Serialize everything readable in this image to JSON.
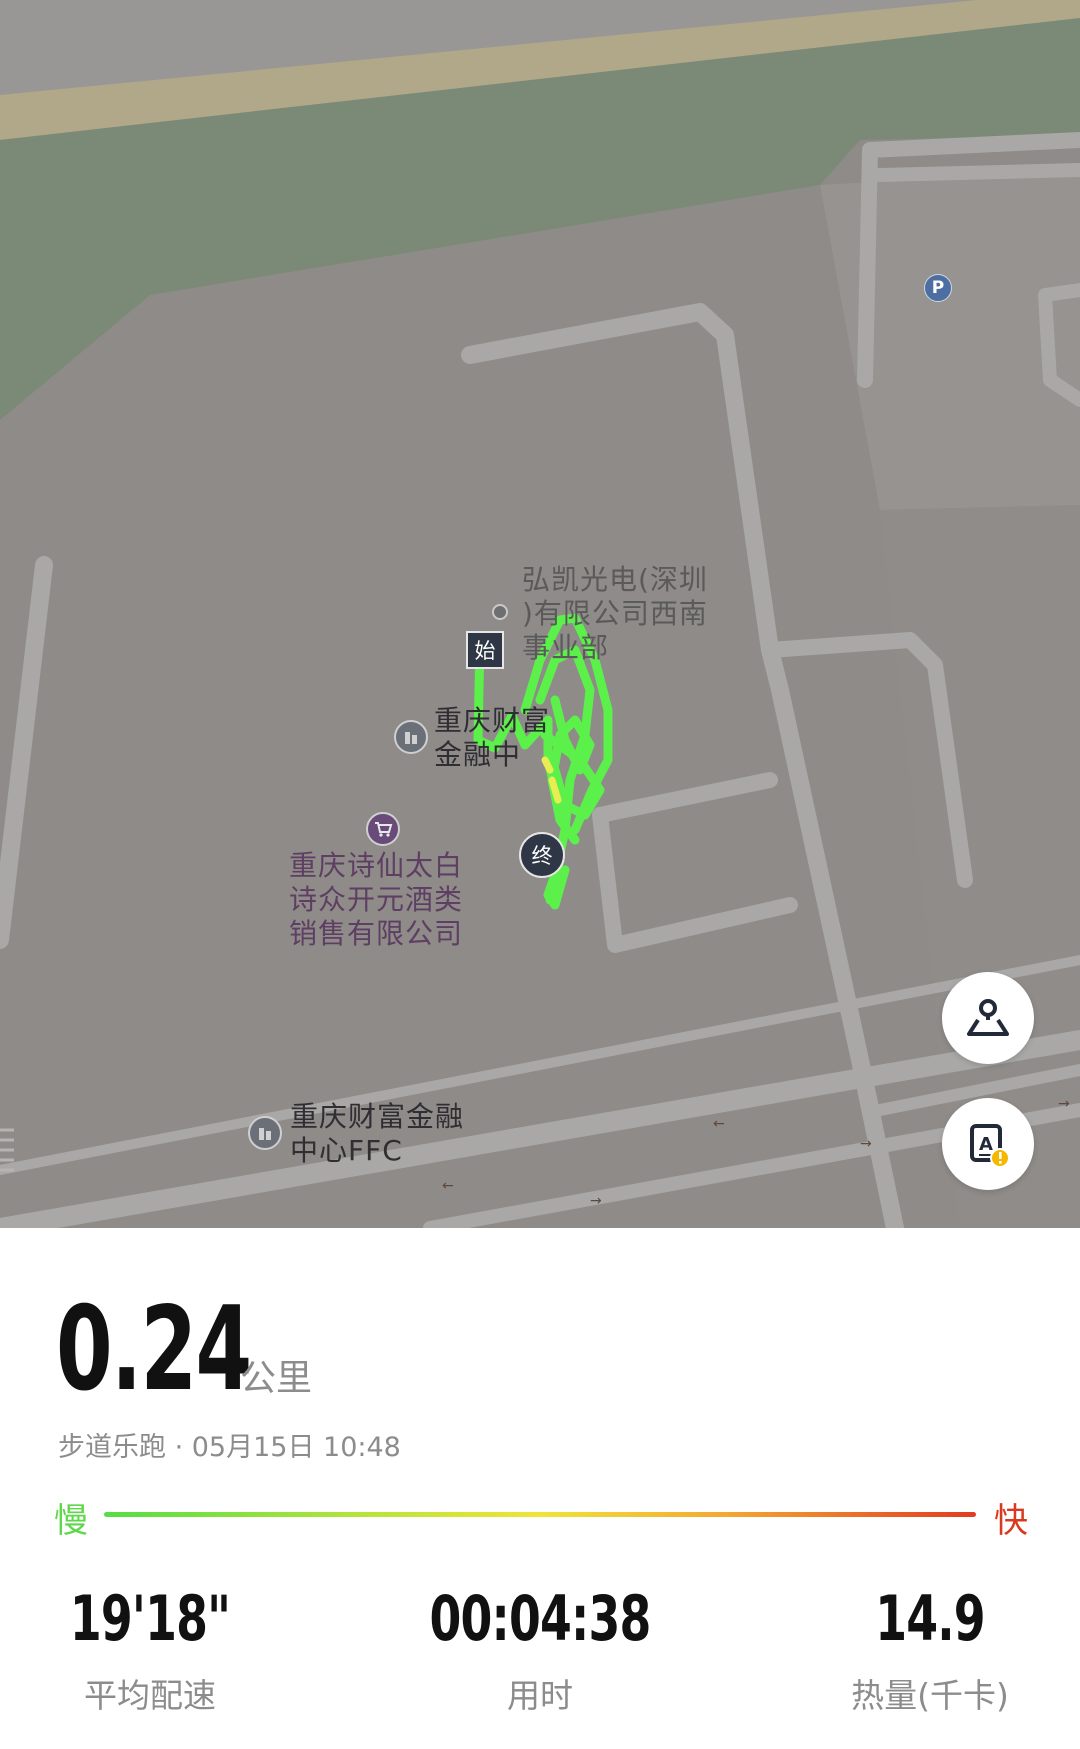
{
  "map": {
    "pois": [
      {
        "name": "弘凯光电(深圳\n)有限公司西南\n事业部"
      },
      {
        "name": "重庆财富\n金融中"
      },
      {
        "name": "重庆诗仙太白\n诗众开元酒类\n销售有限公司"
      },
      {
        "name": "重庆财富金融\n中心FFC"
      }
    ],
    "start_marker": "始",
    "end_marker": "终",
    "track_color": "#5cf04a",
    "icons": [
      "parking-icon",
      "building-icon",
      "shopping-cart-icon",
      "location-person-icon",
      "legend-alert-icon"
    ]
  },
  "summary": {
    "distance": "0.24",
    "distance_unit": "公里",
    "meta": "步道乐跑 · 05月15日 10:48"
  },
  "pace_scale": {
    "slow_label": "慢",
    "fast_label": "快",
    "slow_color": "#5ed74a",
    "fast_color": "#d93a1f"
  },
  "stats": [
    {
      "value": "19'18\"",
      "label": "平均配速"
    },
    {
      "value": "00:04:38",
      "label": "用时"
    },
    {
      "value": "14.9",
      "label": "热量(千卡)"
    }
  ]
}
